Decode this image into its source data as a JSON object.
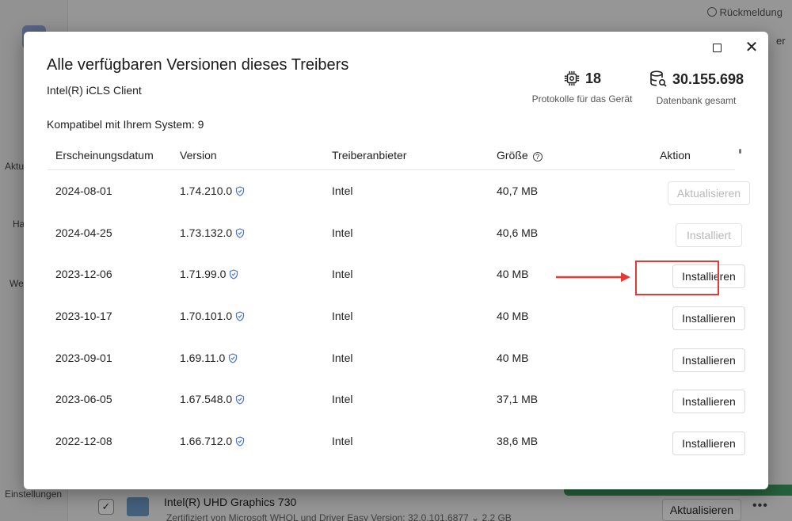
{
  "background": {
    "feedback_label": "Rückmeldung",
    "right_button_fragment": "er",
    "sidebar_labels": [
      "Aktu",
      "Ha",
      "We",
      "Einstellungen"
    ],
    "device_title": "Intel(R) UHD Graphics 730",
    "device_subtitle": "Zertifiziert von Microsoft WHQL und Driver Easy    Version: 32.0.101.6877 ⌄    2,2 GB",
    "update_button": "Aktualisieren",
    "more_label": "•••",
    "check_mark": "✓"
  },
  "modal": {
    "title": "Alle verfügbaren Versionen dieses Treibers",
    "subtitle": "Intel(R) iCLS Client",
    "compatible": "Kompatibel mit Ihrem System: 9",
    "maximize_icon": "maximize-icon",
    "close_label": "✕",
    "stats": [
      {
        "value": "18",
        "label": "Protokolle für das Gerät",
        "icon": "chip-icon"
      },
      {
        "value": "30.155.698",
        "label": "Datenbank gesamt",
        "icon": "database-search-icon"
      }
    ],
    "columns": [
      "Erscheinungsdatum",
      "Version",
      "Treiberanbieter",
      "Größe",
      "Aktion"
    ],
    "size_help_icon": "?",
    "rows": [
      {
        "date": "2024-08-01",
        "version": "1.74.210.0",
        "vendor": "Intel",
        "size": "40,7 MB",
        "action": "Aktualisieren",
        "disabled": true
      },
      {
        "date": "2024-04-25",
        "version": "1.73.132.0",
        "vendor": "Intel",
        "size": "40,6 MB",
        "action": "Installiert",
        "disabled": true
      },
      {
        "date": "2023-12-06",
        "version": "1.71.99.0",
        "vendor": "Intel",
        "size": "40 MB",
        "action": "Installieren",
        "disabled": false,
        "highlighted": true
      },
      {
        "date": "2023-10-17",
        "version": "1.70.101.0",
        "vendor": "Intel",
        "size": "40 MB",
        "action": "Installieren",
        "disabled": false
      },
      {
        "date": "2023-09-01",
        "version": "1.69.11.0",
        "vendor": "Intel",
        "size": "40 MB",
        "action": "Installieren",
        "disabled": false
      },
      {
        "date": "2023-06-05",
        "version": "1.67.548.0",
        "vendor": "Intel",
        "size": "37,1 MB",
        "action": "Installieren",
        "disabled": false
      },
      {
        "date": "2022-12-08",
        "version": "1.66.712.0",
        "vendor": "Intel",
        "size": "38,6 MB",
        "action": "Installieren",
        "disabled": false
      }
    ]
  },
  "colors": {
    "highlight": "#e53935",
    "shield": "#4a74d9",
    "disabled_text": "#b8b8b8"
  }
}
